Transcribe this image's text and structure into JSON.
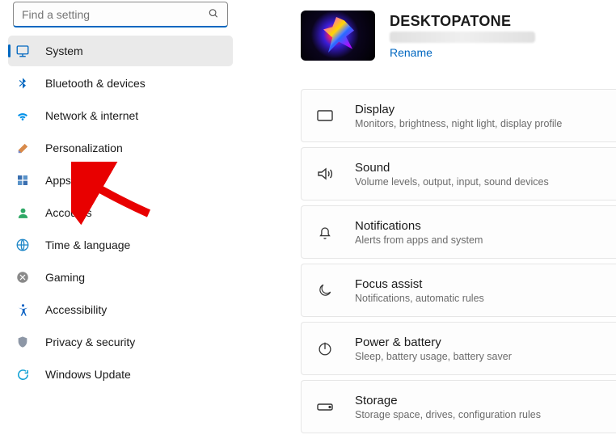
{
  "search": {
    "placeholder": "Find a setting"
  },
  "sidebar": {
    "items": [
      {
        "label": "System"
      },
      {
        "label": "Bluetooth & devices"
      },
      {
        "label": "Network & internet"
      },
      {
        "label": "Personalization"
      },
      {
        "label": "Apps"
      },
      {
        "label": "Accounts"
      },
      {
        "label": "Time & language"
      },
      {
        "label": "Gaming"
      },
      {
        "label": "Accessibility"
      },
      {
        "label": "Privacy & security"
      },
      {
        "label": "Windows Update"
      }
    ]
  },
  "header": {
    "device_name": "DESKTOPATONE",
    "rename_label": "Rename"
  },
  "cards": [
    {
      "title": "Display",
      "desc": "Monitors, brightness, night light, display profile"
    },
    {
      "title": "Sound",
      "desc": "Volume levels, output, input, sound devices"
    },
    {
      "title": "Notifications",
      "desc": "Alerts from apps and system"
    },
    {
      "title": "Focus assist",
      "desc": "Notifications, automatic rules"
    },
    {
      "title": "Power & battery",
      "desc": "Sleep, battery usage, battery saver"
    },
    {
      "title": "Storage",
      "desc": "Storage space, drives, configuration rules"
    }
  ]
}
